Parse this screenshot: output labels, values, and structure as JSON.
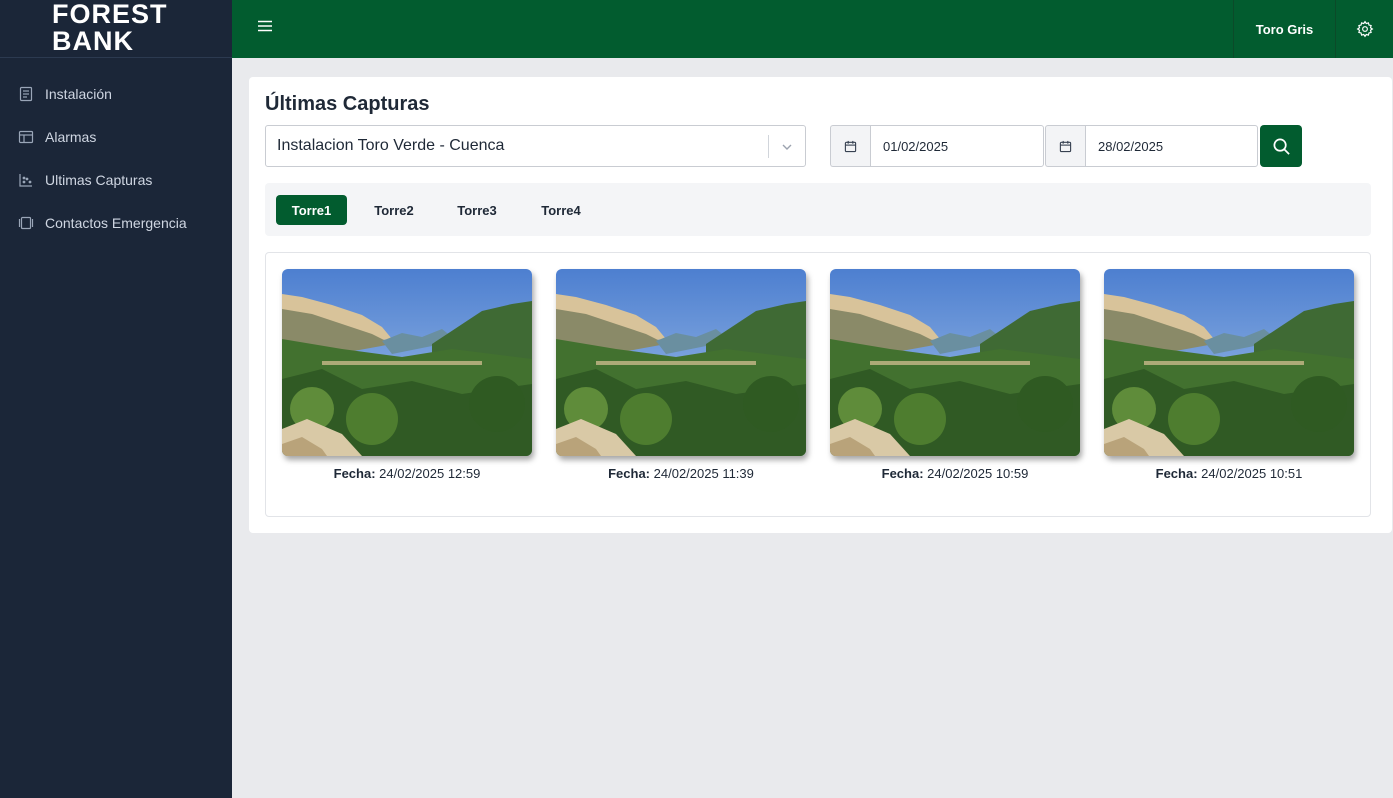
{
  "brand": {
    "line1": "FOREST",
    "line2": "BANK"
  },
  "sidebar": {
    "items": [
      {
        "label": "Instalación",
        "icon": "building-icon"
      },
      {
        "label": "Alarmas",
        "icon": "layout-icon"
      },
      {
        "label": "Ultimas Capturas",
        "icon": "chart-scatter-icon"
      },
      {
        "label": "Contactos Emergencia",
        "icon": "contacts-icon"
      }
    ]
  },
  "topbar": {
    "user": "Toro Gris"
  },
  "main": {
    "title": "Últimas Capturas",
    "installation_select": {
      "value": "Instalacion Toro Verde - Cuenca"
    },
    "date_from": "01/02/2025",
    "date_to": "28/02/2025",
    "tabs": [
      {
        "label": "Torre1",
        "active": true
      },
      {
        "label": "Torre2",
        "active": false
      },
      {
        "label": "Torre3",
        "active": false
      },
      {
        "label": "Torre4",
        "active": false
      }
    ],
    "date_label": "Fecha:",
    "captures": [
      {
        "date": "24/02/2025 12:59"
      },
      {
        "date": "24/02/2025 11:39"
      },
      {
        "date": "24/02/2025 10:59"
      },
      {
        "date": "24/02/2025 10:51"
      }
    ]
  },
  "colors": {
    "primary": "#025c2f",
    "sidebar": "#1b2638",
    "background": "#e9eaed"
  }
}
